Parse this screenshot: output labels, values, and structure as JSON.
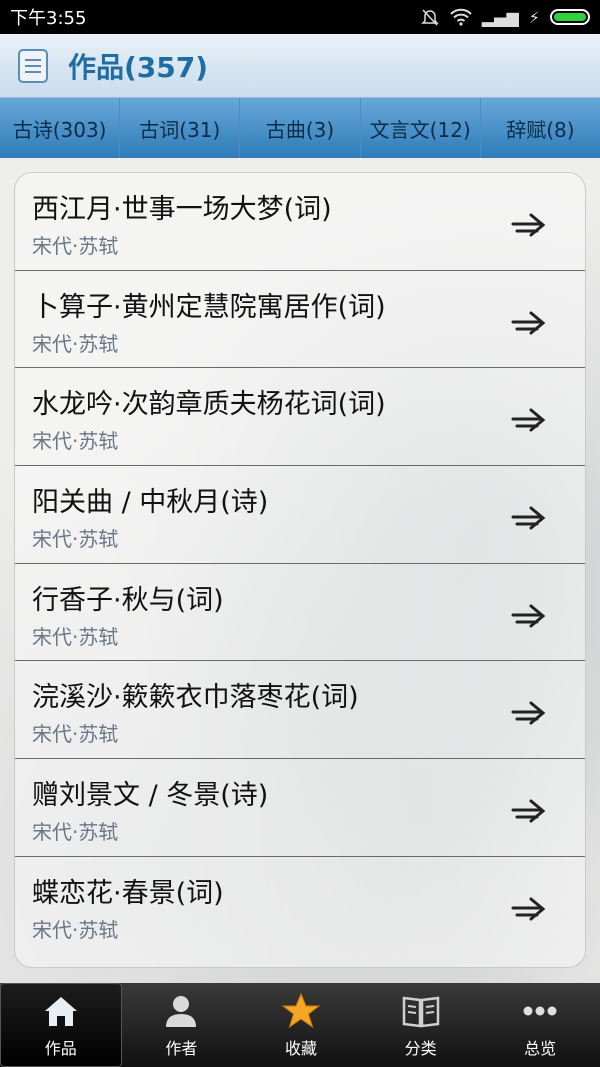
{
  "status_bar": {
    "time": "下午3:55",
    "signal": "▂▄▆",
    "lightning": "⚡"
  },
  "header": {
    "title": "作品(357)"
  },
  "tabs": [
    {
      "label": "古诗(303)"
    },
    {
      "label": "古词(31)"
    },
    {
      "label": "古曲(3)"
    },
    {
      "label": "文言文(12)"
    },
    {
      "label": "辞赋(8)"
    }
  ],
  "list": [
    {
      "title": "西江月·世事一场大梦(词)",
      "subtitle": "宋代·苏轼"
    },
    {
      "title": "卜算子·黄州定慧院寓居作(词)",
      "subtitle": "宋代·苏轼"
    },
    {
      "title": "水龙吟·次韵章质夫杨花词(词)",
      "subtitle": "宋代·苏轼"
    },
    {
      "title": "阳关曲 / 中秋月(诗)",
      "subtitle": "宋代·苏轼"
    },
    {
      "title": "行香子·秋与(词)",
      "subtitle": "宋代·苏轼"
    },
    {
      "title": "浣溪沙·簌簌衣巾落枣花(词)",
      "subtitle": "宋代·苏轼"
    },
    {
      "title": "赠刘景文 / 冬景(诗)",
      "subtitle": "宋代·苏轼"
    },
    {
      "title": "蝶恋花·春景(词)",
      "subtitle": "宋代·苏轼"
    }
  ],
  "bottom_nav": [
    {
      "label": "作品",
      "icon": "home-icon"
    },
    {
      "label": "作者",
      "icon": "person-icon"
    },
    {
      "label": "收藏",
      "icon": "star-icon"
    },
    {
      "label": "分类",
      "icon": "book-icon"
    },
    {
      "label": "总览",
      "icon": "more-icon"
    }
  ],
  "colors": {
    "accent": "#1f6da3",
    "tab_bar": "#2f7cb9",
    "star": "#f5a623"
  }
}
